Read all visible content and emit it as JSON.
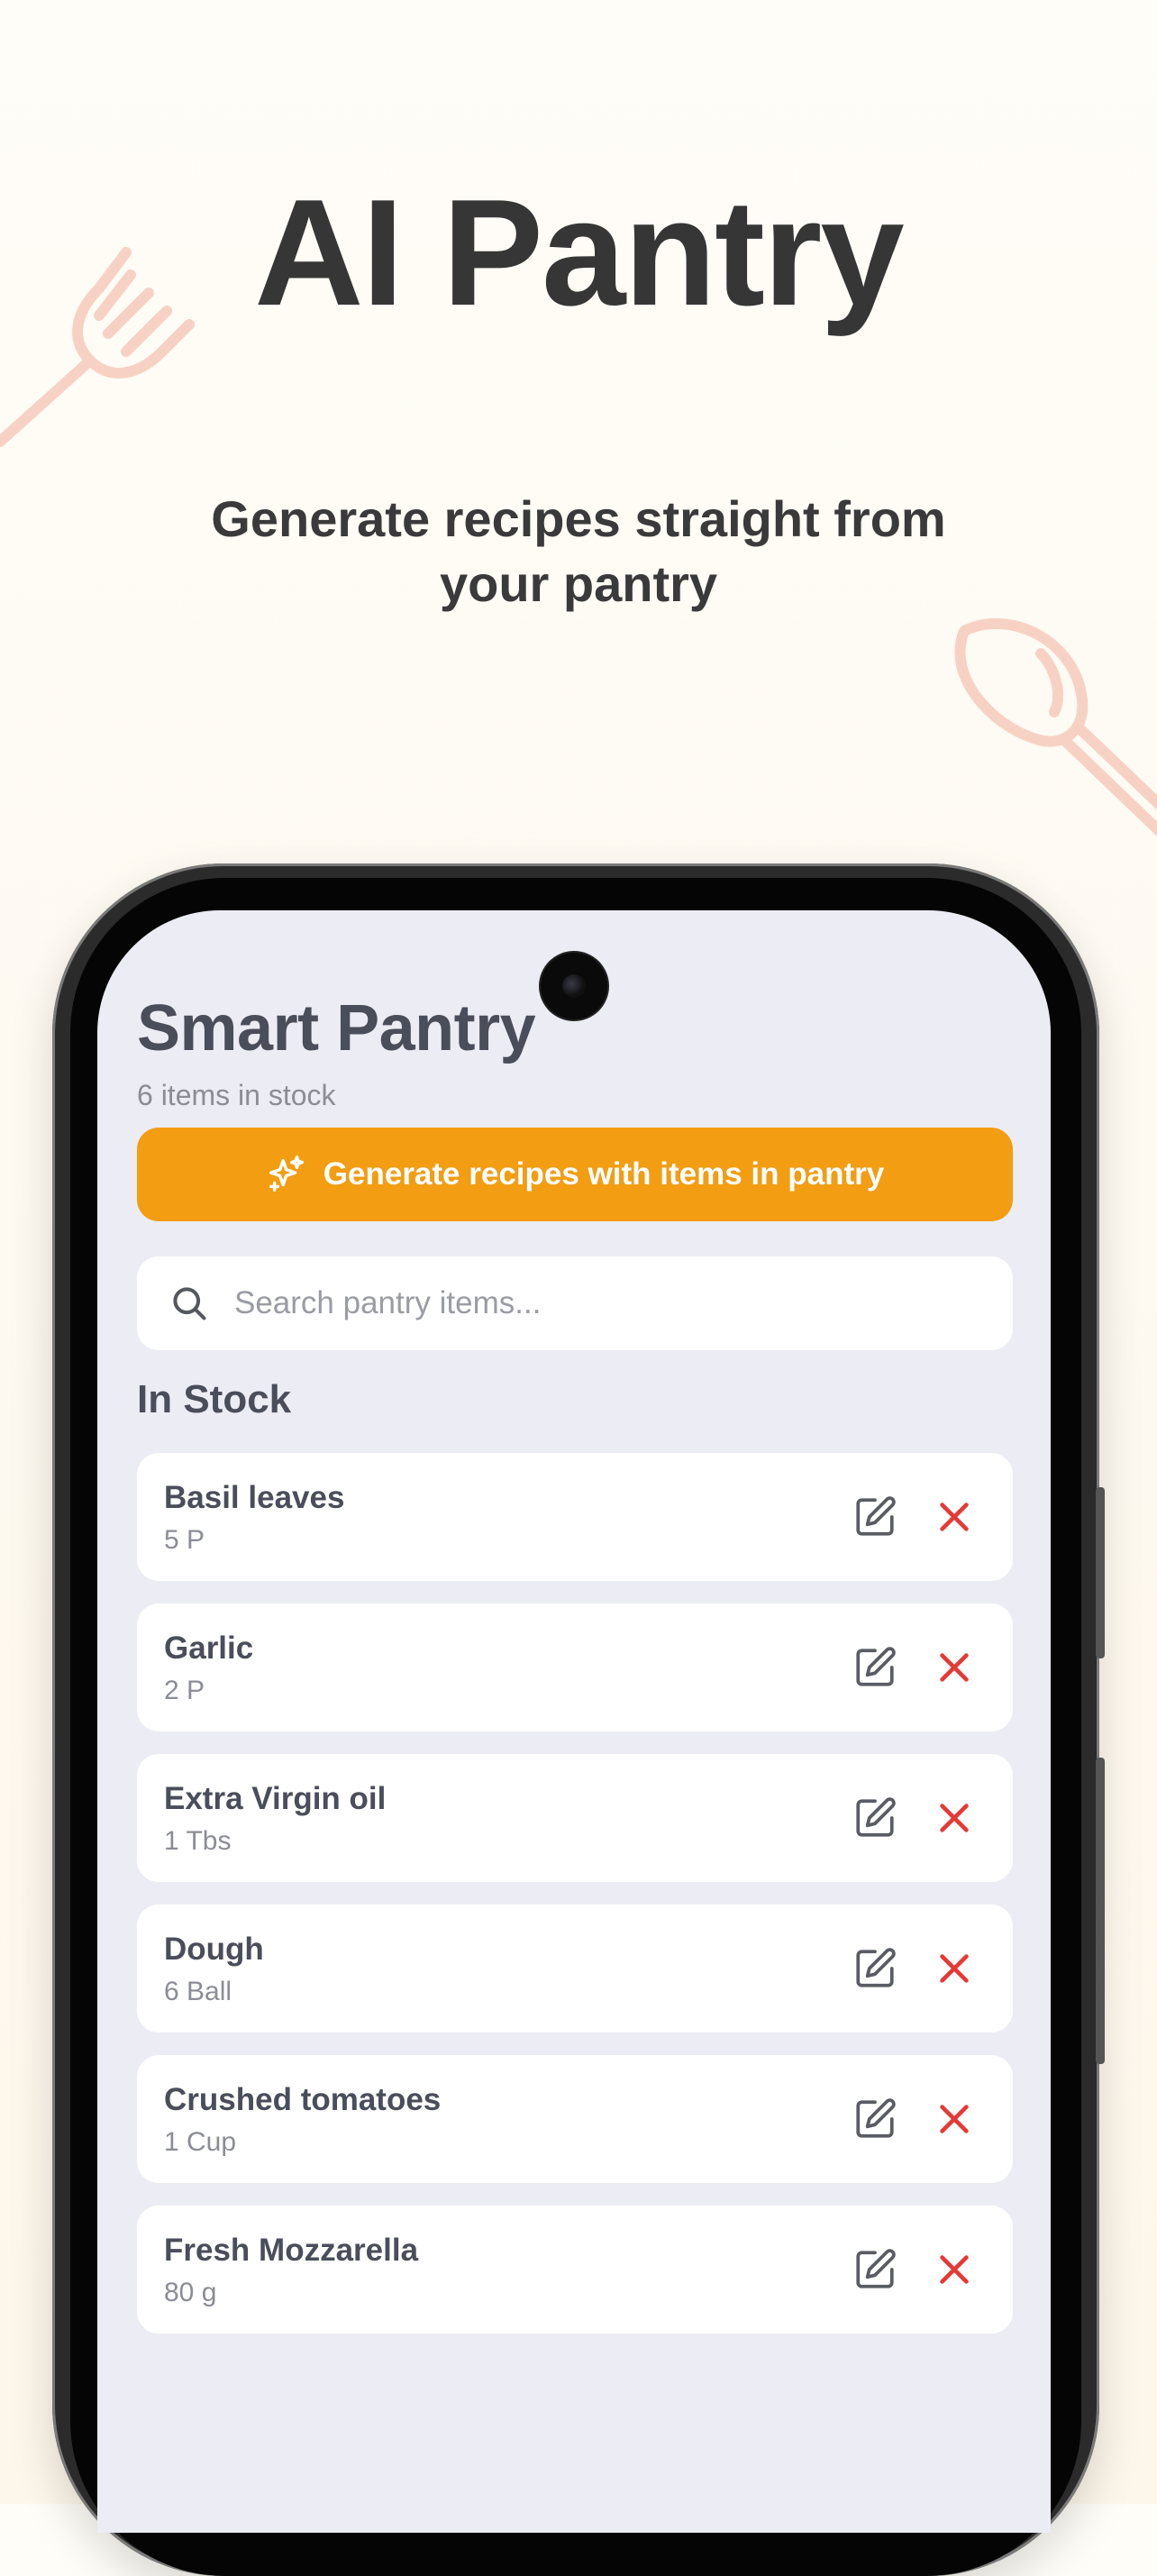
{
  "hero": {
    "title": "AI Pantry",
    "subtitle": "Generate recipes straight from your pantry"
  },
  "app": {
    "title": "Smart Pantry",
    "stock_count": "6 items in stock",
    "generate_button": "Generate recipes with items in pantry",
    "search_placeholder": "Search pantry items...",
    "section_title": "In Stock",
    "items": [
      {
        "name": "Basil leaves",
        "qty": "5 P"
      },
      {
        "name": "Garlic",
        "qty": "2 P"
      },
      {
        "name": "Extra Virgin oil",
        "qty": "1 Tbs"
      },
      {
        "name": "Dough",
        "qty": "6 Ball"
      },
      {
        "name": "Crushed tomatoes",
        "qty": "1 Cup"
      },
      {
        "name": "Fresh Mozzarella",
        "qty": "80 g"
      }
    ]
  },
  "icons": {
    "decor_top_left": "fork-icon",
    "decor_right": "spoon-icon",
    "generate": "sparkles-icon",
    "search": "search-icon",
    "edit": "edit-icon",
    "delete": "close-icon"
  },
  "colors": {
    "accent": "#f29d12",
    "delete": "#e53935",
    "screen_bg": "#ececf4",
    "decor": "#f7d2c4"
  }
}
